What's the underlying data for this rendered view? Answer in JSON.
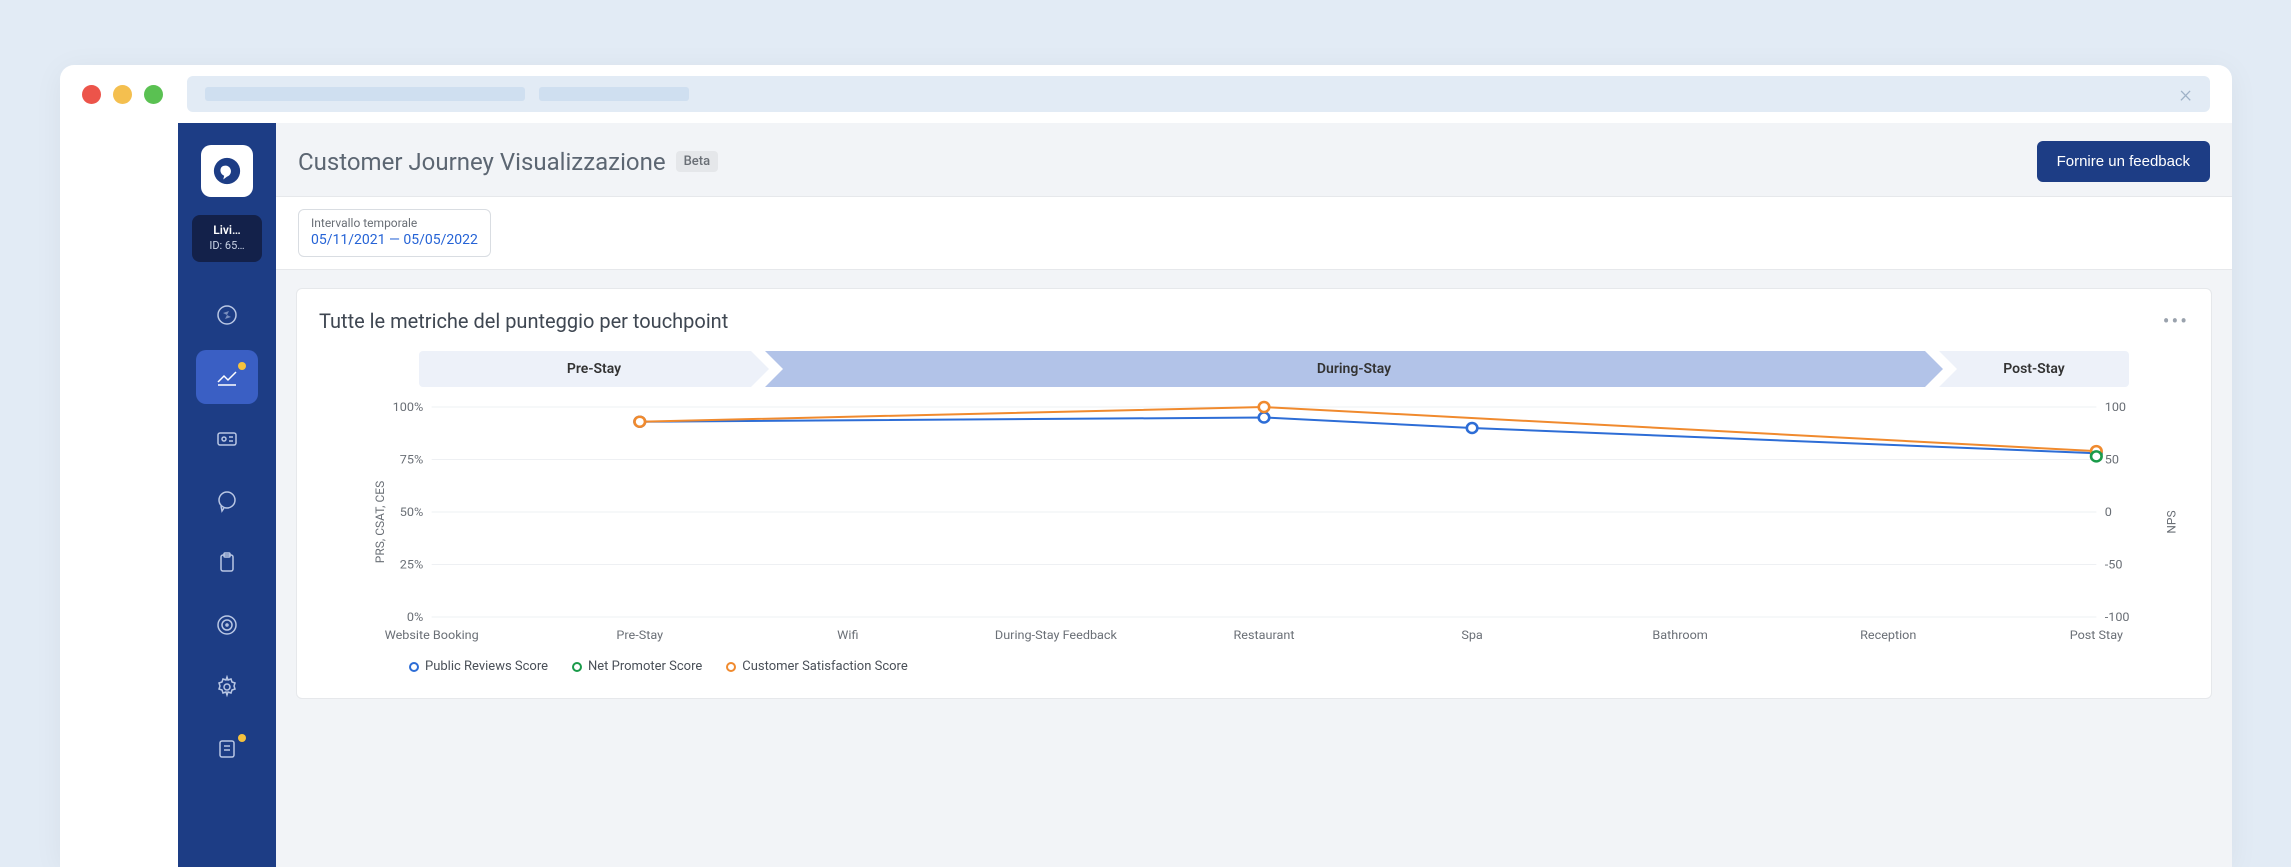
{
  "sidebar": {
    "account_name": "Livi…",
    "account_id": "ID: 65…"
  },
  "header": {
    "title": "Customer Journey Visualizzazione",
    "badge": "Beta",
    "feedback_button": "Fornire un feedback"
  },
  "filter": {
    "label": "Intervallo temporale",
    "value": "05/11/2021 — 05/05/2022"
  },
  "chart": {
    "title": "Tutte le metriche del punteggio per touchpoint",
    "phase_pre": "Pre-Stay",
    "phase_during": "During-Stay",
    "phase_post": "Post-Stay",
    "y_left_label": "PRS, CSAT, CES",
    "y_right_label": "NPS",
    "y_left_ticks": [
      "100%",
      "75%",
      "50%",
      "25%",
      "0%"
    ],
    "y_right_ticks": [
      "100",
      "50",
      "0",
      "-50",
      "-100"
    ],
    "x_categories": [
      "Website Booking",
      "Pre-Stay",
      "Wifi",
      "During-Stay Feedback",
      "Restaurant",
      "Spa",
      "Bathroom",
      "Reception",
      "Post Stay"
    ],
    "legend_prs": "Public Reviews Score",
    "legend_nps": "Net Promoter Score",
    "legend_csat": "Customer Satisfaction Score"
  },
  "chart_data": {
    "type": "line",
    "title": "Tutte le metriche del punteggio per touchpoint",
    "categories": [
      "Website Booking",
      "Pre-Stay",
      "Wifi",
      "During-Stay Feedback",
      "Restaurant",
      "Spa",
      "Bathroom",
      "Reception",
      "Post Stay"
    ],
    "xlabel": "",
    "y_axes": [
      {
        "label": "PRS, CSAT, CES",
        "unit": "%",
        "range": [
          0,
          100
        ],
        "side": "left"
      },
      {
        "label": "NPS",
        "range": [
          -100,
          100
        ],
        "side": "right"
      }
    ],
    "series": [
      {
        "name": "Public Reviews Score",
        "y_axis": "PRS, CSAT, CES",
        "color": "#2d6dd6",
        "values": [
          null,
          93,
          null,
          null,
          95,
          90,
          null,
          null,
          78
        ]
      },
      {
        "name": "Customer Satisfaction Score",
        "y_axis": "PRS, CSAT, CES",
        "color": "#f08a2e",
        "values": [
          null,
          93,
          null,
          null,
          100,
          null,
          null,
          null,
          79
        ]
      },
      {
        "name": "Net Promoter Score",
        "y_axis": "NPS",
        "color": "#1a9b4a",
        "values": [
          null,
          null,
          null,
          null,
          null,
          null,
          null,
          null,
          53
        ]
      }
    ],
    "phases": [
      {
        "name": "Pre-Stay",
        "span": [
          "Website Booking",
          "Pre-Stay"
        ]
      },
      {
        "name": "During-Stay",
        "span": [
          "Wifi",
          "Reception"
        ]
      },
      {
        "name": "Post-Stay",
        "span": [
          "Post Stay",
          "Post Stay"
        ]
      }
    ]
  }
}
